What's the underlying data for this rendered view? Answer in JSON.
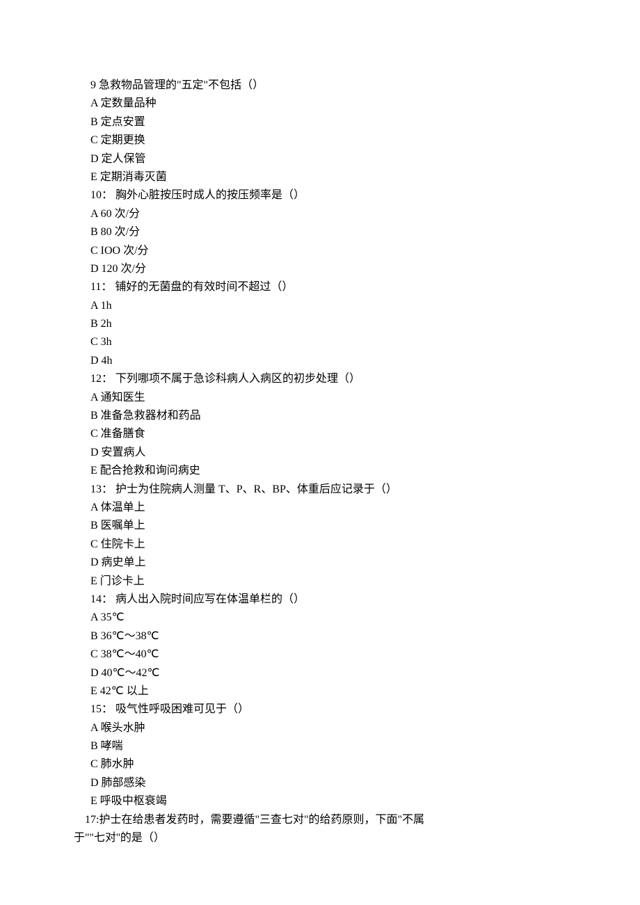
{
  "questions": [
    {
      "number": "9",
      "text": "急救物品管理的\"五定\"不包括（）",
      "options": [
        {
          "letter": "A",
          "text": "定数量品种"
        },
        {
          "letter": "B",
          "text": "定点安置"
        },
        {
          "letter": "C",
          "text": "定期更换"
        },
        {
          "letter": "D",
          "text": "定人保管"
        },
        {
          "letter": "E",
          "text": "定期消毒灭菌"
        }
      ]
    },
    {
      "number": "10：",
      "text": "胸外心脏按压时成人的按压频率是（）",
      "options": [
        {
          "letter": "A",
          "text": "60 次/分"
        },
        {
          "letter": "B",
          "text": "80 次/分"
        },
        {
          "letter": "C",
          "text": "IOO 次/分"
        },
        {
          "letter": "D",
          "text": "120 次/分"
        }
      ]
    },
    {
      "number": "11：",
      "text": "铺好的无菌盘的有效时间不超过（）",
      "options": [
        {
          "letter": "A",
          "text": "1h"
        },
        {
          "letter": "B",
          "text": "2h"
        },
        {
          "letter": "C",
          "text": "3h"
        },
        {
          "letter": "D",
          "text": "4h"
        }
      ]
    },
    {
      "number": "12：",
      "text": "下列哪项不属于急诊科病人入病区的初步处理（）",
      "options": [
        {
          "letter": "A",
          "text": "通知医生"
        },
        {
          "letter": "B",
          "text": "准备急救器材和药品"
        },
        {
          "letter": "C",
          "text": "准备膳食"
        },
        {
          "letter": "D",
          "text": "安置病人"
        },
        {
          "letter": "E",
          "text": "配合抢救和询问病史"
        }
      ]
    },
    {
      "number": "13：",
      "text": "护士为住院病人测量 T、P、R、BP、体重后应记录于（）",
      "options": [
        {
          "letter": "A",
          "text": "体温单上"
        },
        {
          "letter": "B",
          "text": "医嘱单上"
        },
        {
          "letter": "C",
          "text": "住院卡上"
        },
        {
          "letter": "D",
          "text": "病史单上"
        },
        {
          "letter": "E",
          "text": "门诊卡上"
        }
      ]
    },
    {
      "number": "14：",
      "text": "病人出入院时间应写在体温单栏的（）",
      "options": [
        {
          "letter": "A",
          "text": "35℃"
        },
        {
          "letter": "B",
          "text": "36℃～38℃"
        },
        {
          "letter": "C",
          "text": "38℃～40℃"
        },
        {
          "letter": "D",
          "text": "40℃～42℃"
        },
        {
          "letter": "E",
          "text": "42℃ 以上"
        }
      ]
    },
    {
      "number": "15：",
      "text": "吸气性呼吸困难可见于（）",
      "options": [
        {
          "letter": "A",
          "text": "喉头水肿"
        },
        {
          "letter": "B",
          "text": "哮喘"
        },
        {
          "letter": "C",
          "text": "肺水肿"
        },
        {
          "letter": "D",
          "text": "肺部感染"
        },
        {
          "letter": "E",
          "text": "呼吸中枢衰竭"
        }
      ]
    }
  ],
  "finalQuestion": {
    "line1": "　17:护士在给患者发药时，需要遵循\"三查七对\"的给药原则，下面\"不属",
    "line2": "于\"\"七对''的是（）"
  }
}
